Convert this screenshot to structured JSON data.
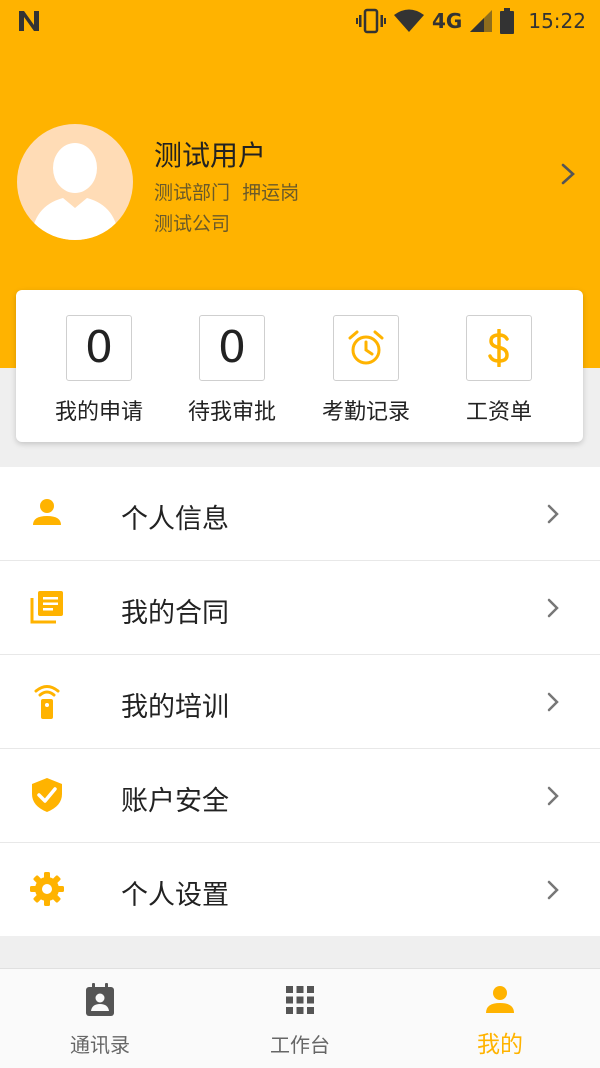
{
  "status_bar": {
    "network": "4G",
    "time": "15:22"
  },
  "colors": {
    "accent": "#ffb300",
    "background": "#efefef",
    "text": "#222222"
  },
  "profile": {
    "name": "测试用户",
    "department_role": "测试部门  押运岗",
    "company": "测试公司"
  },
  "quick_actions": [
    {
      "type": "count",
      "value": "0",
      "label": "我的申请"
    },
    {
      "type": "count",
      "value": "0",
      "label": "待我审批"
    },
    {
      "type": "icon",
      "icon": "alarm-clock-icon",
      "label": "考勤记录"
    },
    {
      "type": "icon",
      "icon": "dollar-icon",
      "label": "工资单"
    }
  ],
  "menu": [
    {
      "icon": "person-icon",
      "label": "个人信息"
    },
    {
      "icon": "contract-icon",
      "label": "我的合同"
    },
    {
      "icon": "training-icon",
      "label": "我的培训"
    },
    {
      "icon": "shield-check-icon",
      "label": "账户安全"
    },
    {
      "icon": "gear-icon",
      "label": "个人设置"
    }
  ],
  "tabs": [
    {
      "icon": "contacts-icon",
      "label": "通讯录",
      "active": false
    },
    {
      "icon": "grid-icon",
      "label": "工作台",
      "active": false
    },
    {
      "icon": "person-icon",
      "label": "我的",
      "active": true
    }
  ]
}
